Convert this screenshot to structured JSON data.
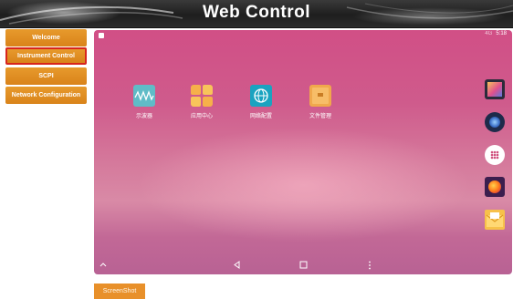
{
  "header": {
    "title": "Web Control"
  },
  "sidebar": {
    "items": [
      {
        "label": "Welcome",
        "active": false
      },
      {
        "label": "Instrument Control",
        "active": true
      },
      {
        "label": "SCPI",
        "active": false
      },
      {
        "label": "Network Configuration",
        "active": false
      }
    ]
  },
  "screen": {
    "status": {
      "network": "4G",
      "time": "5:18"
    },
    "apps": [
      {
        "label": "示波器",
        "icon": "oscilloscope-app-icon"
      },
      {
        "label": "应用中心",
        "icon": "app-center-icon"
      },
      {
        "label": "网络配置",
        "icon": "network-config-icon"
      },
      {
        "label": "文件管理",
        "icon": "file-manager-icon"
      }
    ],
    "side_icons": [
      "gallery-icon",
      "music-icon",
      "app-drawer-icon",
      "firefox-icon",
      "email-icon"
    ],
    "nav_icons": [
      "chevron-up-icon",
      "back-icon",
      "home-icon",
      "menu-dots-icon"
    ]
  },
  "footer": {
    "screenshot_label": "ScreenShot"
  },
  "colors": {
    "accent": "#e8902a",
    "active_border": "#d8251c",
    "header_bg": "#2a2a2a"
  }
}
